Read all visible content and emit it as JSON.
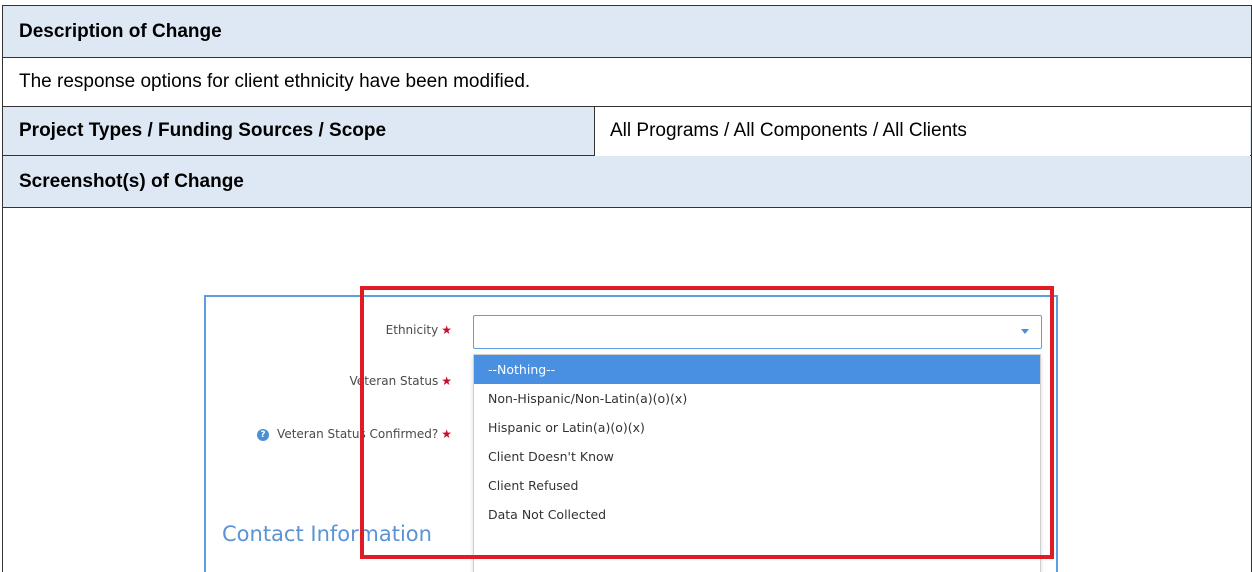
{
  "doc": {
    "desc_header": "Description of Change",
    "desc_text": "The response options for client ethnicity have been modified.",
    "scope_header": "Project Types / Funding Sources / Scope",
    "scope_value": "All Programs / All Components / All Clients",
    "screens_header": "Screenshot(s) of Change"
  },
  "form": {
    "ethnicity_label": "Ethnicity",
    "veteran_label": "Veteran Status",
    "veteran_confirmed_label": "Veteran Status Confirmed?",
    "required_mark": "★",
    "help_icon": "?",
    "section_title": "Contact Information",
    "select_value": ""
  },
  "dropdown": {
    "options": [
      "--Nothing--",
      "Non-Hispanic/Non-Latin(a)(o)(x)",
      "Hispanic or Latin(a)(o)(x)",
      "Client Doesn't Know",
      "Client Refused",
      "Data Not Collected"
    ],
    "selected_index": 0
  },
  "colors": {
    "header_bg": "#dde8f4",
    "accent": "#4a90e2",
    "highlight": "#e01b24"
  }
}
